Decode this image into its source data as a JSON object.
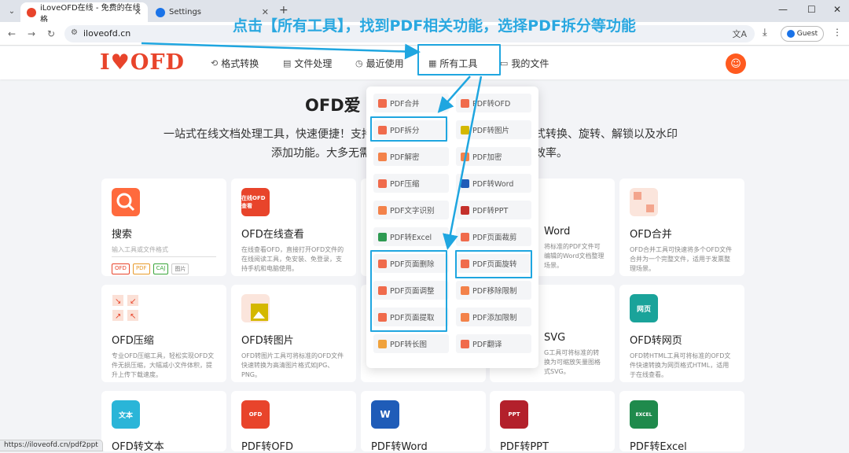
{
  "browser": {
    "tab_active_title": "iLoveOFD在线 - 免费的在线格",
    "tab_inactive_title": "Settings",
    "url": "iloveofd.cn",
    "profile_label": "Guest",
    "status_url": "https://iloveofd.cn/pdf2ppt"
  },
  "annotation": {
    "instruction": "点击【所有工具】，找到PDF相关功能，选择PDF拆分等功能",
    "color": "#1fa6e0"
  },
  "site": {
    "logo": "I♥OFD",
    "nav": [
      {
        "label": "格式转换",
        "icon": "convert-icon"
      },
      {
        "label": "文件处理",
        "icon": "file-icon"
      },
      {
        "label": "最近使用",
        "icon": "clock-icon"
      },
      {
        "label": "所有工具",
        "icon": "grid-icon"
      },
      {
        "label": "我的文件",
        "icon": "folder-icon"
      }
    ],
    "brand_color": "#e8442b"
  },
  "hero": {
    "title_left": "OFD爱",
    "title_right": "",
    "line1_left": "一站式在线文档处理工具，快速便捷！支持",
    "line1_right": "式转换、旋转、解锁以及水印",
    "line2_left": "添加功能。大多无需",
    "line2_right": "效率。"
  },
  "dropdown": {
    "left": [
      "PDF合并",
      "PDF拆分",
      "PDF解密",
      "PDF压缩",
      "PDF文字识别",
      "PDF转Excel",
      "PDF页面删除",
      "PDF页面调整",
      "PDF页面提取",
      "PDF转长图"
    ],
    "right": [
      "PDF转OFD",
      "PDF转图片",
      "PDF加密",
      "PDF转Word",
      "PDF转PPT",
      "PDF页面裁剪",
      "PDF页面旋转",
      "PDF移除限制",
      "PDF添加限制",
      "PDF翻译"
    ]
  },
  "cards": {
    "search": {
      "title": "搜索",
      "placeholder": "输入工具或文件格式",
      "tags": [
        "OFD",
        "PDF",
        "CAJ",
        "图片"
      ]
    },
    "ofd_view": {
      "title": "OFD在线查看",
      "icon_text": "在线OFD查看",
      "desc": "在线查看OFD，直接打开OFD文件的在线阅读工具，免安装、免登录，支持手机和电脑使用。"
    },
    "ofd_word": {
      "title": "Word",
      "desc": "将标准的PDF文件可编辑的Word文档整理场景。"
    },
    "ofd_merge": {
      "title": "OFD合并",
      "desc": "OFD合并工具可快速将多个OFD文件合并为一个完整文件，适用于发票整理场景。"
    },
    "ofd_compress": {
      "title": "OFD压缩",
      "desc": "专业OFD压缩工具，轻松实现OFD文件无损压缩，大幅减小文件体积，提升上传下载速度。"
    },
    "ofd_image": {
      "title": "OFD转图片",
      "desc": "OFD转图片工具可将标准的OFD文件快速转换为高清图片格式如JPG、PNG。"
    },
    "ofd_svg": {
      "title": "SVG",
      "desc": "G工具可将标准的转换为可缩放矢量图格式SVG。"
    },
    "ofd_web": {
      "title": "OFD转网页",
      "icon_text": "网页",
      "desc": "OFD转HTML工具可将标准的OFD文件快速转换为网页格式HTML，适用于在线查看。"
    },
    "ofd_text": {
      "title": "OFD转文本",
      "icon_text": "文本"
    },
    "pdf_ofd": {
      "title": "PDF转OFD",
      "icon_text": "OFD"
    },
    "pdf_word": {
      "title": "PDF转Word",
      "icon_text": "W"
    },
    "pdf_ppt": {
      "title": "PDF转PPT",
      "icon_text": "PPT"
    },
    "pdf_excel": {
      "title": "PDF转Excel",
      "icon_text": "EXCEL"
    }
  }
}
